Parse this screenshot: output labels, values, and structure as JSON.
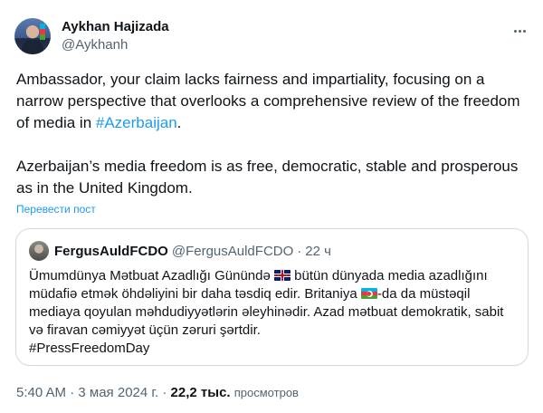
{
  "author": {
    "display_name": "Aykhan Hajizada",
    "handle": "@Aykhanh",
    "avatar_icon": "profile-photo"
  },
  "tweet": {
    "paragraph1_text": "Ambassador, your claim lacks fairness and impartiality, focusing on a narrow perspective that overlooks a comprehensive review of the freedom of media in ",
    "paragraph1_hashtag": "#Azerbaijan",
    "paragraph1_end": ".",
    "paragraph2_text": "Azerbaijan’s media freedom is as free, democratic, stable and prosperous as in the United Kingdom.",
    "translate_label": "Перевести пост"
  },
  "quote": {
    "display_name": "FergusAuldFCDO",
    "handle": "@FergusAuldFCDO",
    "separator": "·",
    "time": "22 ч",
    "text_part1": "Ümumdünya Mətbuat Azadlığı Günündə ",
    "text_part2": " bütün dünyada media azadlığını müdafiə etmək öhdəliyini bir daha təsdiq edir. Britaniya ",
    "text_part3": "-da da müstəqil mediaya qoyulan məhdudiyyətlərin əleyhinədir. Azad mətbuat demokratik, sabit və firavan cəmiyyət üçün zəruri şərtdir.",
    "hashtag": "#PressFreedomDay",
    "flag1_icon": "uk-flag",
    "flag2_icon": "azerbaijan-flag"
  },
  "meta": {
    "time": "5:40 AM",
    "dot": "·",
    "date": "3 мая 2024 г.",
    "views_count": "22,2 тыс.",
    "views_label": "просмотров"
  },
  "colors": {
    "link": "#1d9bf0",
    "text": "#0f1419",
    "secondary": "#536471",
    "border": "#cfd9de"
  }
}
